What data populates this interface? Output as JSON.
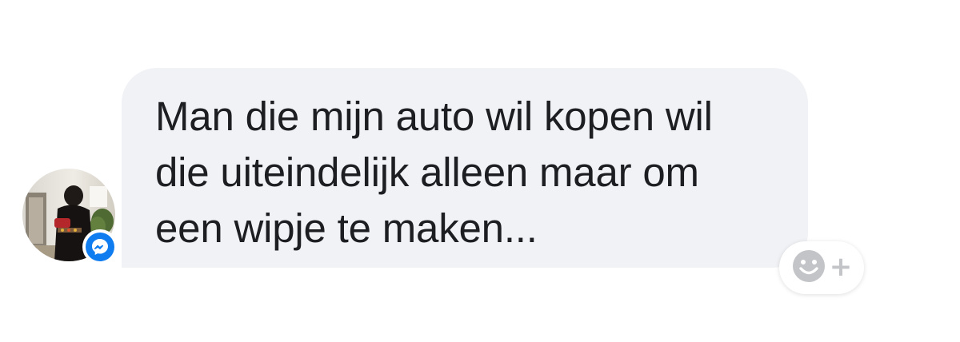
{
  "message": {
    "lines": [
      "Man die mijn auto wil kopen wil",
      "die uiteindelijk alleen maar om",
      "een wipje te maken..."
    ],
    "text": "Man die mijn auto wil kopen wil\ndie uiteindelijk alleen maar om\neen wipje te maken...",
    "bubble_color": "#f1f2f5",
    "text_color": "#1c1e21"
  },
  "sender": {
    "avatar_icon": "profile-photo",
    "badge_icon": "messenger-icon",
    "badge_color": "#0f7cf0"
  },
  "reaction": {
    "icon": "smiley-icon",
    "plus_label": "+"
  }
}
